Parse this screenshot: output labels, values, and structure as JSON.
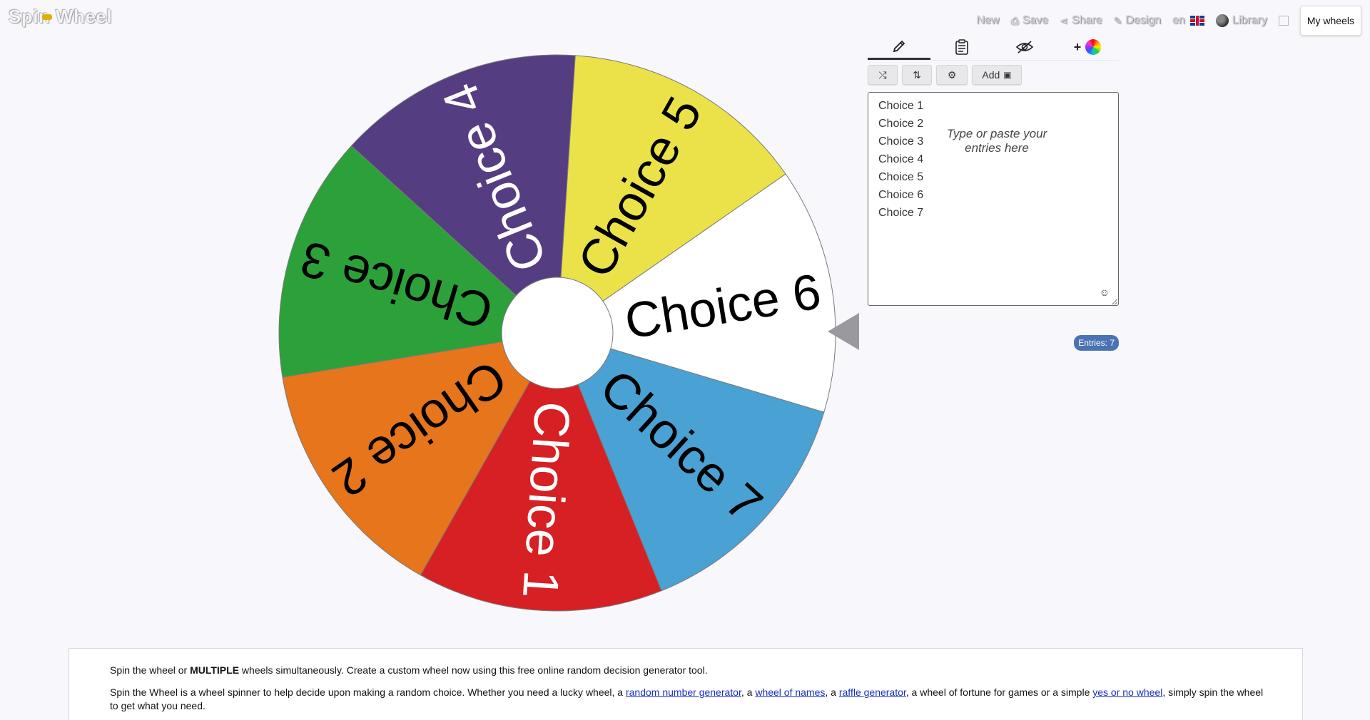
{
  "app": {
    "logo": "Spin Wheel"
  },
  "nav": {
    "new": "New",
    "save": "Save",
    "share": "Share",
    "design": "Design",
    "language": "en",
    "library": "Library",
    "my_wheels": "My wheels"
  },
  "wheel": {
    "segments": [
      {
        "label": "Choice 1",
        "color": "#d62024",
        "text_color": "#ffffff"
      },
      {
        "label": "Choice 2",
        "color": "#e6751c",
        "text_color": "#000000"
      },
      {
        "label": "Choice 3",
        "color": "#2ca139",
        "text_color": "#000000"
      },
      {
        "label": "Choice 4",
        "color": "#553d82",
        "text_color": "#ffffff"
      },
      {
        "label": "Choice 5",
        "color": "#ebe24a",
        "text_color": "#000000"
      },
      {
        "label": "Choice 6",
        "color": "#ffffff",
        "text_color": "#000000"
      },
      {
        "label": "Choice 7",
        "color": "#4aa1d3",
        "text_color": "#000000"
      }
    ]
  },
  "editor": {
    "tabs": [
      "edit",
      "results",
      "hide",
      "add"
    ],
    "add_button": "Add",
    "entries": [
      "Choice 1",
      "Choice 2",
      "Choice 3",
      "Choice 4",
      "Choice 5",
      "Choice 6",
      "Choice 7"
    ],
    "placeholder": "Type or paste your entries here",
    "entries_count": "Entries: 7"
  },
  "info": {
    "line1_a": "Spin the wheel or ",
    "line1_bold": "MULTIPLE",
    "line1_b": " wheels simultaneously. Create a custom wheel now using this free online random decision generator tool.",
    "line2_a": "Spin the Wheel is a wheel spinner to help decide upon making a random choice. Whether you need a lucky wheel, a ",
    "link_rng": "random number generator",
    "sep1": ", a ",
    "link_names": "wheel of names",
    "sep2": ", a ",
    "link_raffle": "raffle generator",
    "line2_b": ", a wheel of fortune for games or a simple ",
    "link_yesno": "yes or no wheel",
    "line2_c": ", simply spin the wheel",
    "line3": "to get what you need."
  }
}
